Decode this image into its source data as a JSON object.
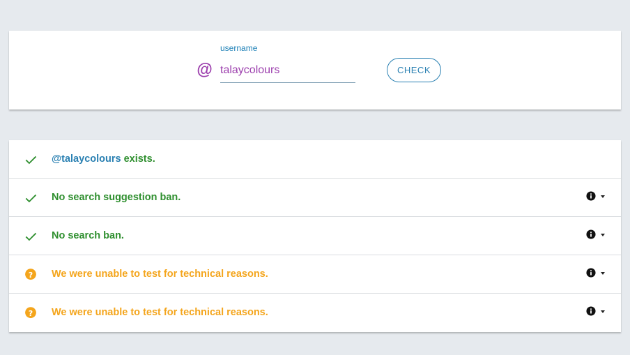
{
  "search": {
    "at_symbol": "@",
    "label": "username",
    "value": "talaycolours",
    "button_label": "CHECK"
  },
  "results": [
    {
      "status": "ok",
      "icon": "check-icon",
      "handle": "@talaycolours",
      "text": " exists.",
      "has_details": false
    },
    {
      "status": "ok",
      "icon": "check-icon",
      "text": "No search suggestion ban.",
      "has_details": true
    },
    {
      "status": "ok",
      "icon": "check-icon",
      "text": "No search ban.",
      "has_details": true
    },
    {
      "status": "warn",
      "icon": "question-icon",
      "text": "We were unable to test for technical reasons.",
      "has_details": true
    },
    {
      "status": "warn",
      "icon": "question-icon",
      "text": "We were unable to test for technical reasons.",
      "has_details": true
    }
  ],
  "colors": {
    "background": "#e6eaee",
    "ok": "#2f8f2f",
    "warn": "#f4a51c",
    "accent": "#2a80b2",
    "handle": "#9c3fad"
  }
}
